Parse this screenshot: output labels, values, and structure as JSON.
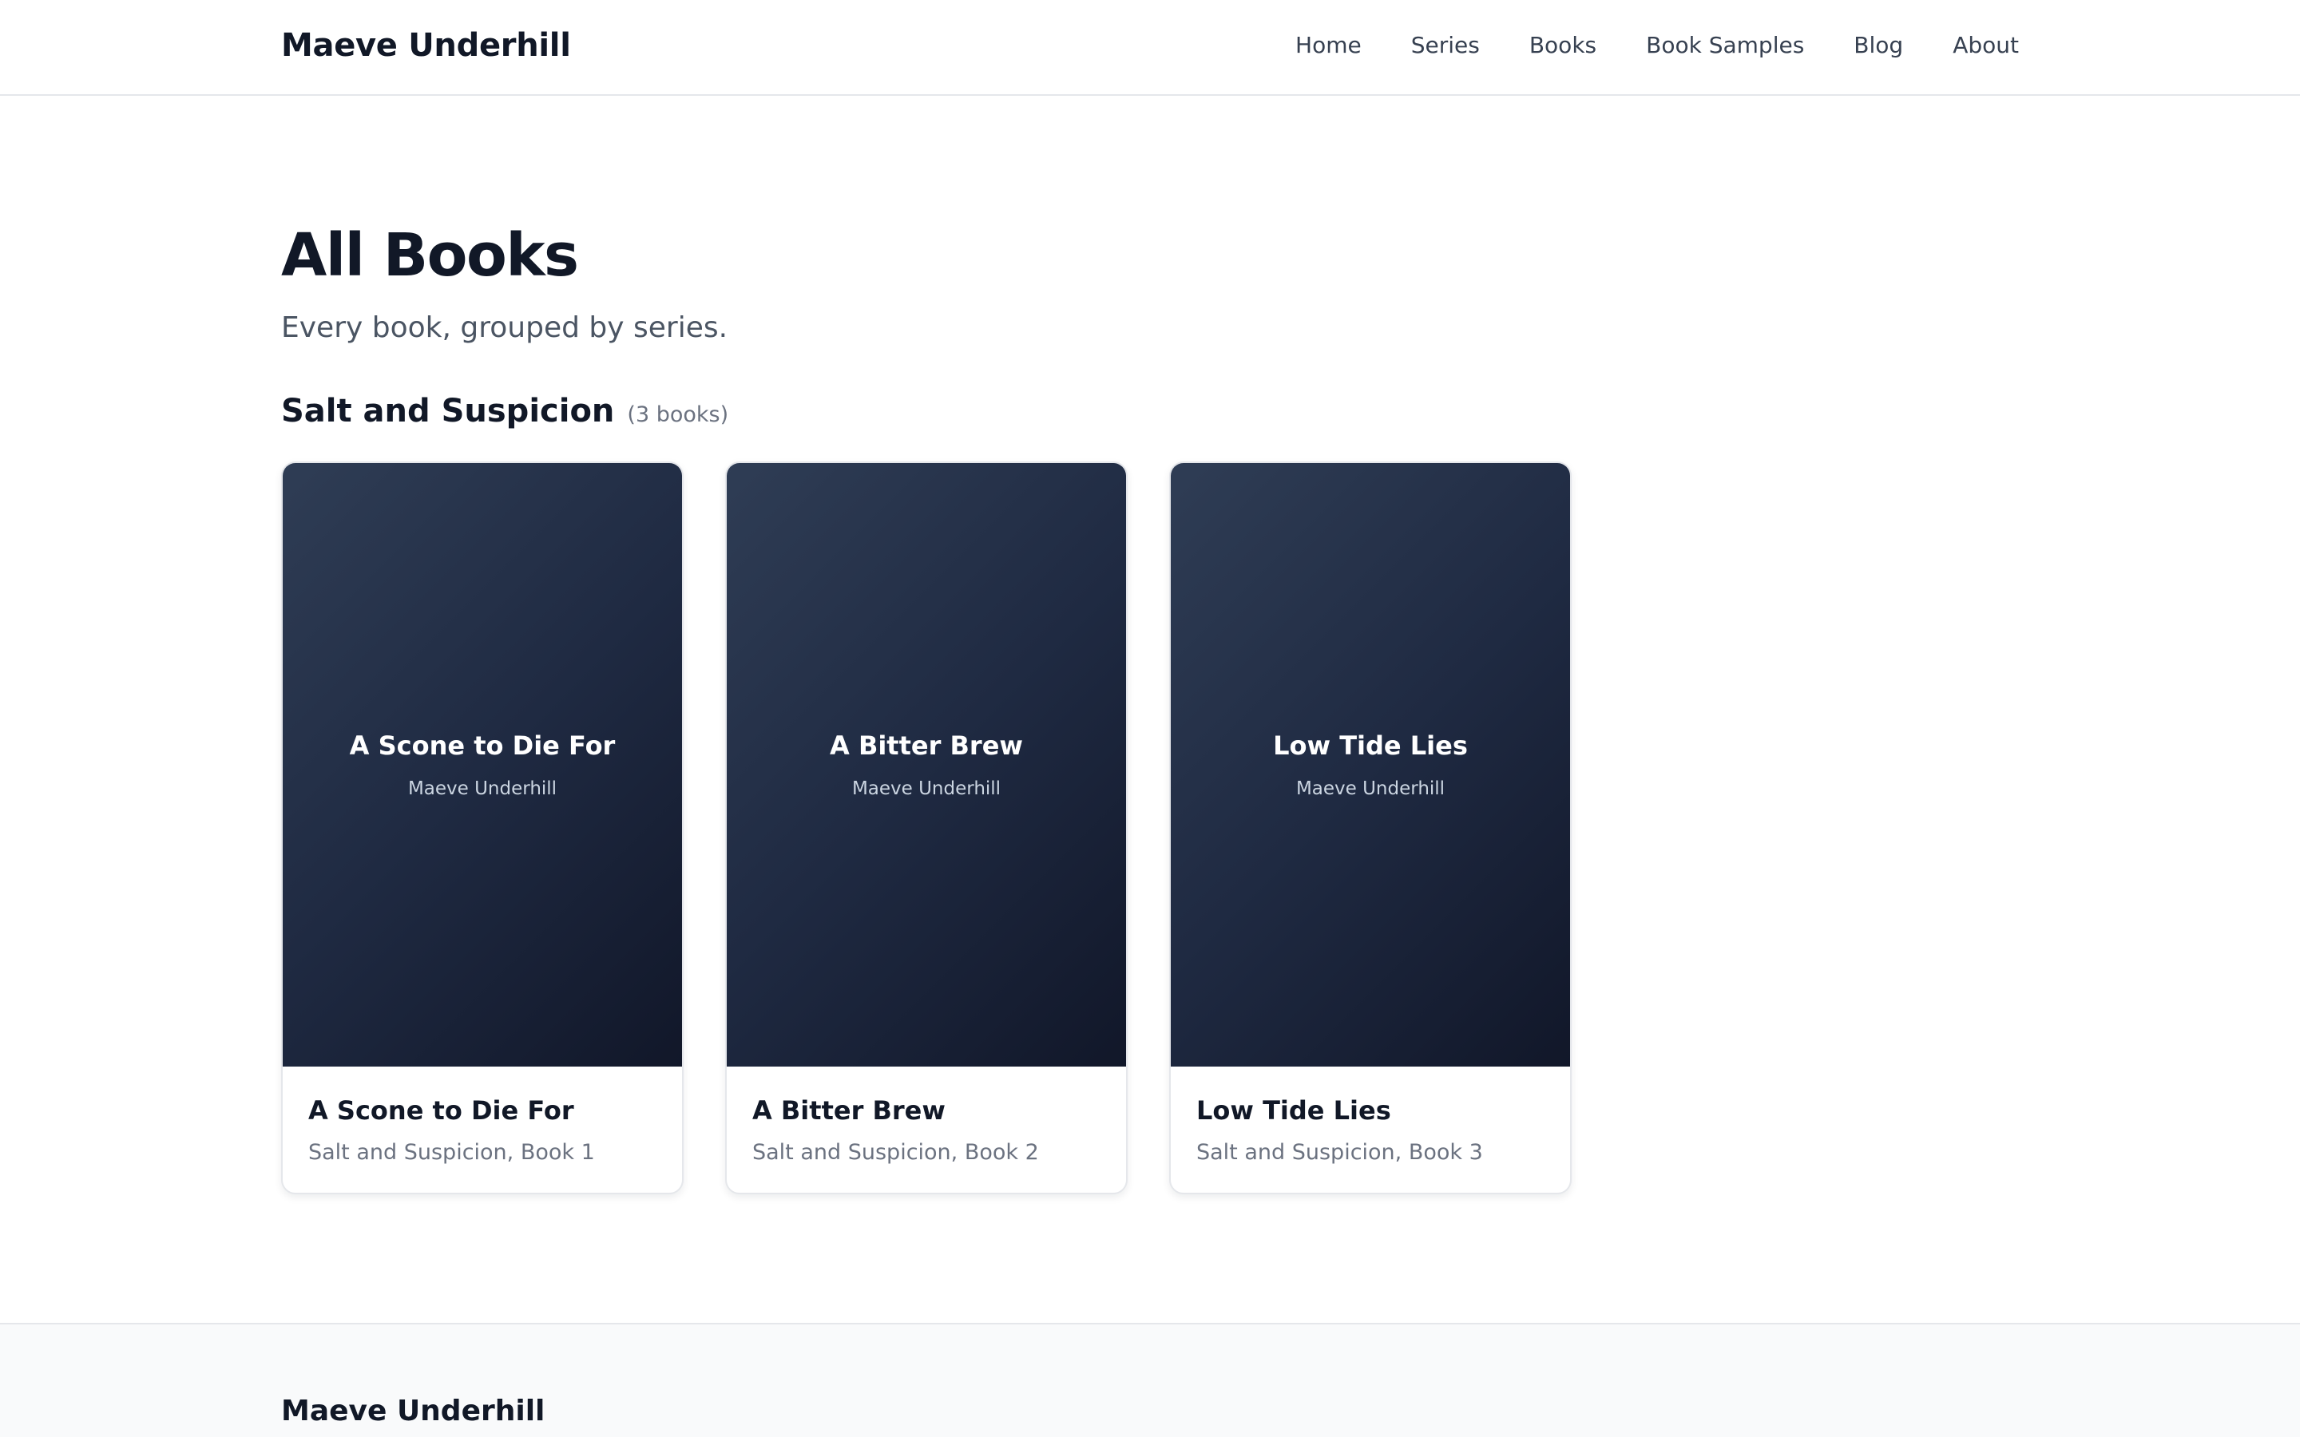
{
  "header": {
    "brand": "Maeve Underhill",
    "nav": [
      {
        "label": "Home"
      },
      {
        "label": "Series"
      },
      {
        "label": "Books"
      },
      {
        "label": "Book Samples"
      },
      {
        "label": "Blog"
      },
      {
        "label": "About"
      }
    ]
  },
  "main": {
    "title": "All Books",
    "subtitle": "Every book, grouped by series.",
    "series": [
      {
        "name": "Salt and Suspicion",
        "count": "(3 books)",
        "books": [
          {
            "cover_title": "A Scone to Die For",
            "cover_author": "Maeve Underhill",
            "title": "A Scone to Die For",
            "meta": "Salt and Suspicion, Book 1"
          },
          {
            "cover_title": "A Bitter Brew",
            "cover_author": "Maeve Underhill",
            "title": "A Bitter Brew",
            "meta": "Salt and Suspicion, Book 2"
          },
          {
            "cover_title": "Low Tide Lies",
            "cover_author": "Maeve Underhill",
            "title": "Low Tide Lies",
            "meta": "Salt and Suspicion, Book 3"
          }
        ]
      }
    ]
  },
  "footer": {
    "brand": "Maeve Underhill"
  },
  "colors": {
    "text_primary": "#111827",
    "text_secondary": "#6b7280",
    "cover_gradient_start": "#2f3d55",
    "cover_gradient_end": "#111729",
    "border": "#e5e7eb",
    "footer_bg": "#f9fafb"
  }
}
